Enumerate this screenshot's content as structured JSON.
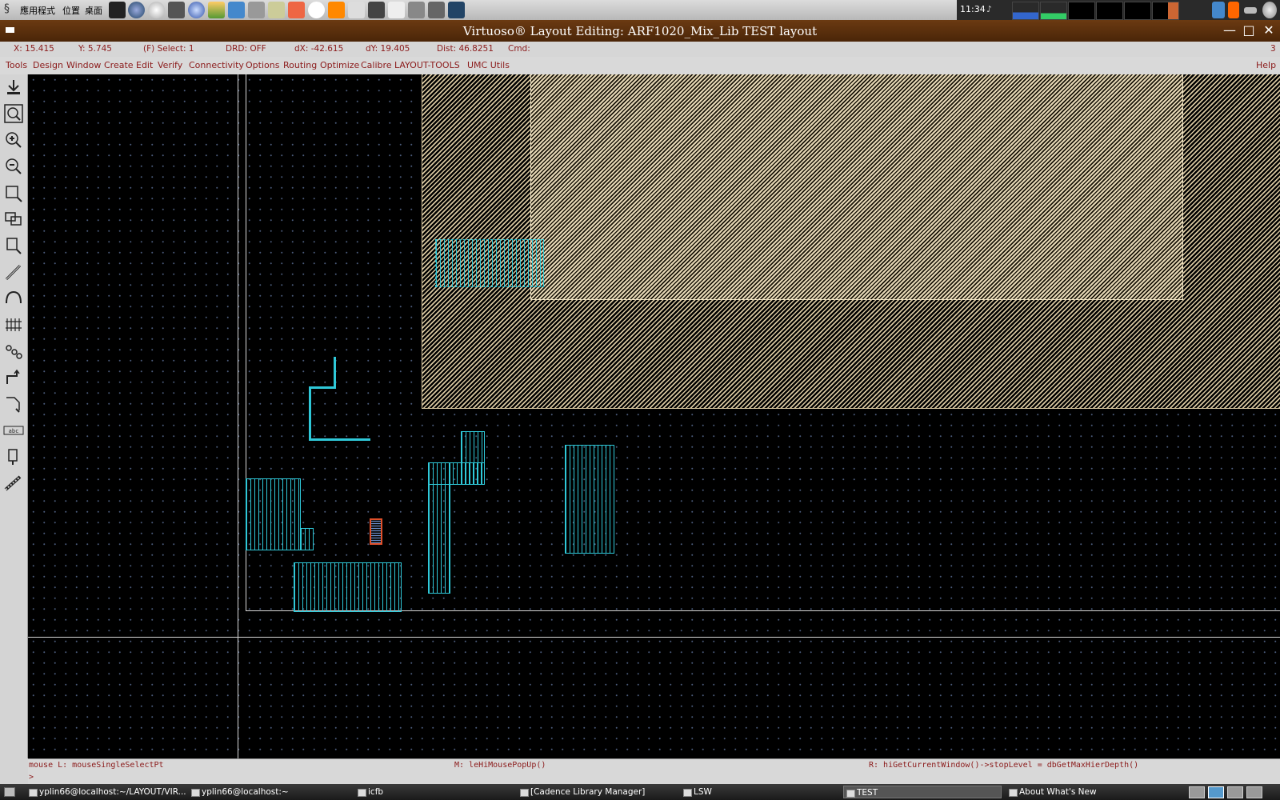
{
  "system_panel": {
    "menus": [
      "應用程式",
      "位置",
      "桌面"
    ],
    "clock": "11:34"
  },
  "window": {
    "title": "Virtuoso® Layout Editing: ARF1020_Mix_Lib TEST layout",
    "number": "3"
  },
  "status": {
    "x": "X: 15.415",
    "y": "Y: 5.745",
    "select": "(F) Select: 1",
    "drd": "DRD: OFF",
    "dx": "dX: -42.615",
    "dy": "dY: 19.405",
    "dist": "Dist: 46.8251",
    "cmd": "Cmd:"
  },
  "menubar": {
    "items": [
      "Tools",
      "Design",
      "Window",
      "Create",
      "Edit",
      "Verify",
      "Connectivity",
      "Options",
      "Routing",
      "Optimize",
      "Calibre",
      "LAYOUT-TOOLS",
      "UMC Utils"
    ],
    "help": "Help"
  },
  "toolbar": {
    "icons": [
      "save-icon",
      "zoom-fit-icon",
      "zoom-in-icon",
      "zoom-out-icon",
      "rectangle-icon",
      "polygon-icon",
      "instance-icon",
      "path-icon",
      "arc-icon",
      "mosaic-icon",
      "stretch-icon",
      "wire-icon",
      "move-icon",
      "label-icon",
      "pin-icon",
      "ruler-icon"
    ]
  },
  "ciw": {
    "mouse_l": "mouse L: mouseSingleSelectPt",
    "mouse_m": "M: leHiMousePopUp()",
    "mouse_r": "R: hiGetCurrentWindow()->stopLevel = dbGetMaxHierDepth()",
    "prompt": ">"
  },
  "taskbar": {
    "tasks": [
      "yplin66@localhost:~/LAYOUT/VIR...",
      "yplin66@localhost:~",
      "icfb",
      "[Cadence Library Manager]",
      "LSW",
      "TEST",
      "About What's New"
    ]
  }
}
